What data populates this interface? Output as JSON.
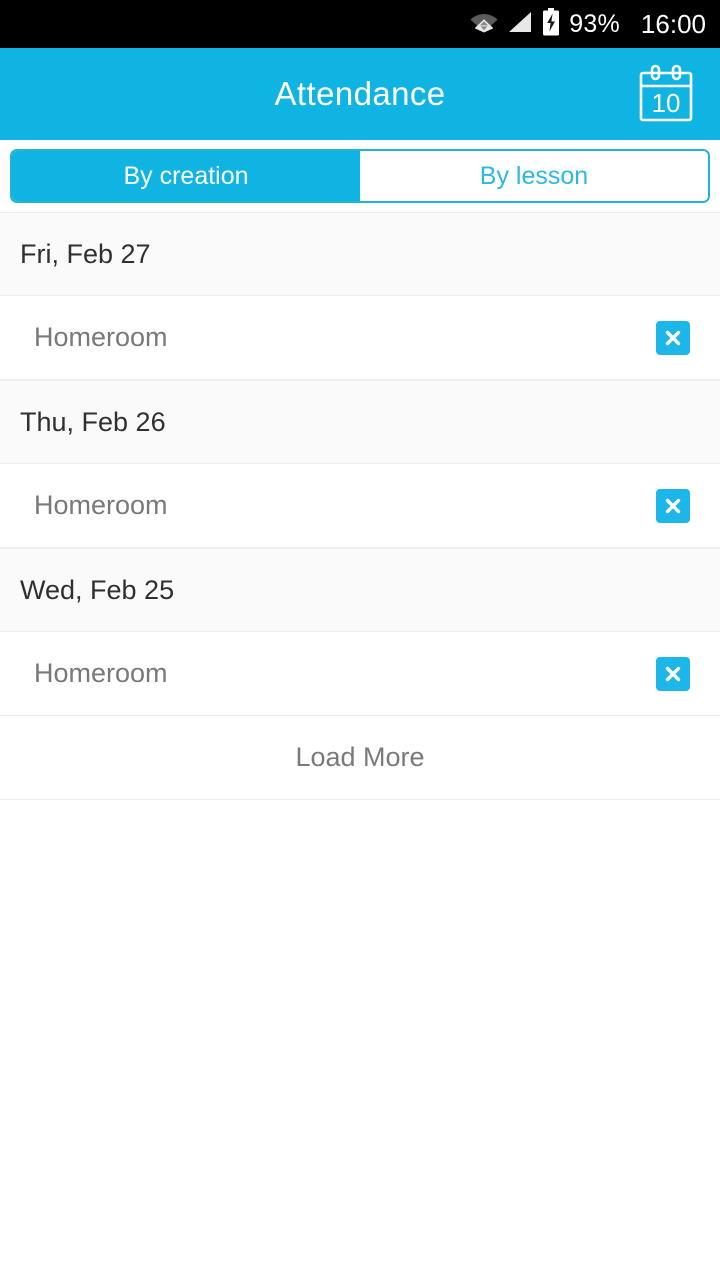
{
  "statusbar": {
    "wifi_icon": "wifi-icon",
    "signal_icon": "cellular-signal-icon",
    "battery_icon": "battery-charging-icon",
    "battery_percent": "93%",
    "clock": "16:00"
  },
  "appbar": {
    "title": "Attendance",
    "calendar_icon": "calendar-icon",
    "calendar_day": "10",
    "background": "#10b4e3"
  },
  "tabs": {
    "active_index": 0,
    "items": [
      {
        "label": "By creation"
      },
      {
        "label": "By lesson"
      }
    ],
    "accent": "#10b4e3",
    "border": "#24b3d8",
    "inactive_text": "#2cb8e0"
  },
  "list": {
    "groups": [
      {
        "date": "Fri, Feb 27",
        "rows": [
          {
            "label": "Homeroom",
            "delete_icon": "close-icon"
          }
        ]
      },
      {
        "date": "Thu, Feb 26",
        "rows": [
          {
            "label": "Homeroom",
            "delete_icon": "close-icon"
          }
        ]
      },
      {
        "date": "Wed, Feb 25",
        "rows": [
          {
            "label": "Homeroom",
            "delete_icon": "close-icon"
          }
        ]
      }
    ],
    "load_more_label": "Load More",
    "delete_button_color": "#1cb7e8"
  }
}
